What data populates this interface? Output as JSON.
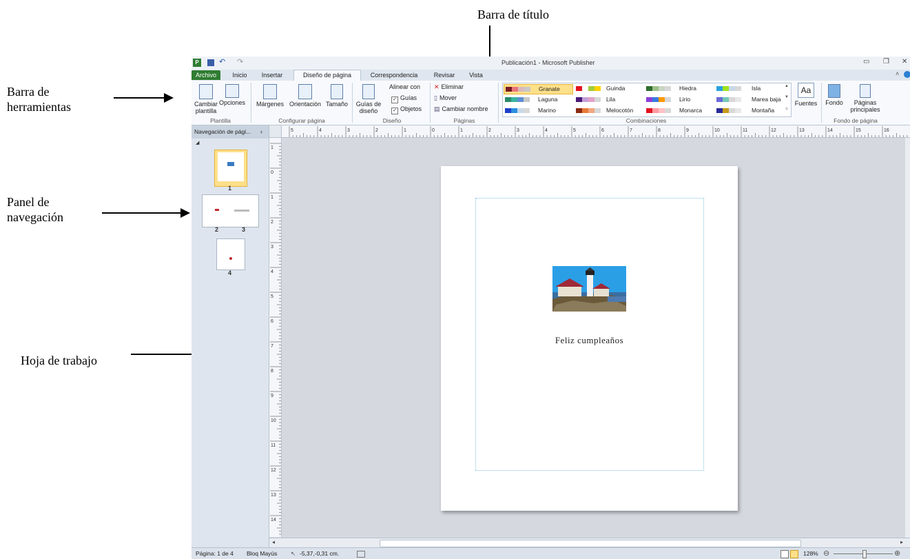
{
  "annotations": {
    "title_bar": "Barra de título",
    "toolbar": "Barra de herramientas",
    "nav_panel": "Panel de navegación",
    "worksheet": "Hoja de trabajo"
  },
  "window": {
    "title": "Publicación1 - Microsoft Publisher",
    "app_icon": "P"
  },
  "tabs": [
    "Archivo",
    "Inicio",
    "Insertar",
    "Diseño de página",
    "Correspondencia",
    "Revisar",
    "Vista"
  ],
  "ribbon": {
    "plantilla": {
      "cambiar": "Cambiar plantilla",
      "opciones": "Opciones",
      "group": "Plantilla"
    },
    "configurar": {
      "margenes": "Márgenes",
      "orientacion": "Orientación",
      "tamano": "Tamaño",
      "group": "Configurar página"
    },
    "diseno": {
      "guias_diseno": "Guías de diseño",
      "alinear_con": "Alinear con",
      "guias": "Guías",
      "objetos": "Objetos",
      "group": "Diseño"
    },
    "paginas": {
      "eliminar": "Eliminar",
      "mover": "Mover",
      "cambiar_nombre": "Cambiar nombre",
      "group": "Páginas"
    },
    "combinaciones": {
      "group": "Combinaciones",
      "schemes": [
        {
          "name": "Granate",
          "colors": [
            "#7a1b22",
            "#e9747a",
            "#d9b9bd",
            "#c0c0c0"
          ]
        },
        {
          "name": "Guinda",
          "colors": [
            "#e2131f",
            "#ffffff",
            "#a2cc3a",
            "#ffd200"
          ]
        },
        {
          "name": "Hiedra",
          "colors": [
            "#2e6e2e",
            "#9cbf8a",
            "#c8d6c0",
            "#d8d8d8"
          ]
        },
        {
          "name": "Isla",
          "colors": [
            "#28a2e0",
            "#9fe31e",
            "#c8d8e8",
            "#d8d8d8"
          ]
        },
        {
          "name": "Laguna",
          "colors": [
            "#2a8a6a",
            "#39b4a0",
            "#5f8fd0",
            "#c8c8c8"
          ]
        },
        {
          "name": "Lila",
          "colors": [
            "#4a1a78",
            "#c3a0d8",
            "#e3a2c8",
            "#d8d8d8"
          ]
        },
        {
          "name": "Lirio",
          "colors": [
            "#8b3fd9",
            "#3a7ae0",
            "#ff9900",
            "#d8d8d8"
          ]
        },
        {
          "name": "Marea baja",
          "colors": [
            "#6a6ad8",
            "#74c9b6",
            "#d8d8d8",
            "#e8e8e8"
          ]
        },
        {
          "name": "Marino",
          "colors": [
            "#1d3fc8",
            "#2c8ee0",
            "#c8d8e8",
            "#d8d8d8"
          ]
        },
        {
          "name": "Melocotón",
          "colors": [
            "#8a2a12",
            "#e87a3a",
            "#f0a880",
            "#d8d8d8"
          ]
        },
        {
          "name": "Monarca",
          "colors": [
            "#e2131f",
            "#ff9aa0",
            "#ffc0c4",
            "#d8d8d8"
          ]
        },
        {
          "name": "Montaña",
          "colors": [
            "#2a2a9a",
            "#c89a1a",
            "#d8d8d8",
            "#e8e8e8"
          ]
        }
      ]
    },
    "fuentes": "Fuentes",
    "fondo": {
      "fondo": "Fondo",
      "paginas_principales": "Páginas principales",
      "group": "Fondo de página"
    }
  },
  "nav_pane": {
    "title": "Navegación de pági...",
    "pages": [
      "1",
      "2",
      "3",
      "4"
    ]
  },
  "document": {
    "caption": "Feliz cumpleaños"
  },
  "rulers": {
    "horizontal": [
      "5",
      "4",
      "3",
      "2",
      "1",
      "0",
      "1",
      "2",
      "3",
      "4",
      "5",
      "6",
      "7",
      "8",
      "9",
      "10",
      "11",
      "12",
      "13",
      "14",
      "15",
      "16"
    ],
    "vertical": [
      "1",
      "0",
      "1",
      "2",
      "3",
      "4",
      "5",
      "6",
      "7",
      "8",
      "9",
      "10",
      "11",
      "12",
      "13",
      "14"
    ]
  },
  "status": {
    "page": "Página: 1 de 4",
    "caps": "Bloq Mayús",
    "position": "-5,37,-0,31 cm.",
    "zoom": "128%"
  }
}
